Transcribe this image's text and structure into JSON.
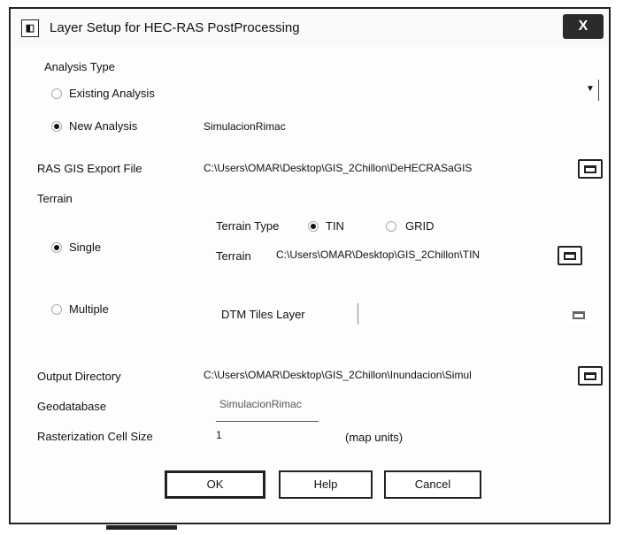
{
  "window": {
    "title": "Layer Setup for HEC-RAS PostProcessing",
    "close_label": "X"
  },
  "analysis": {
    "section_label": "Analysis Type",
    "existing_label": "Existing Analysis",
    "new_label": "New Analysis",
    "new_name": "SimulacionRimac",
    "selected": "new"
  },
  "export": {
    "label": "RAS GIS Export File",
    "path": "C:\\Users\\OMAR\\Desktop\\GIS_2Chillon\\DeHECRASaGIS"
  },
  "terrain": {
    "section_label": "Terrain",
    "single_label": "Single",
    "multiple_label": "Multiple",
    "mode_selected": "single",
    "type_label": "Terrain Type",
    "tin_label": "TIN",
    "grid_label": "GRID",
    "type_selected": "TIN",
    "terrain_label": "Terrain",
    "terrain_path": "C:\\Users\\OMAR\\Desktop\\GIS_2Chillon\\TIN",
    "dtm_label": "DTM Tiles Layer"
  },
  "output": {
    "label": "Output Directory",
    "path": "C:\\Users\\OMAR\\Desktop\\GIS_2Chillon\\Inundacion\\Simul"
  },
  "geodatabase": {
    "label": "Geodatabase",
    "value": "SimulacionRimac"
  },
  "raster": {
    "label": "Rasterization Cell Size",
    "value": "1",
    "units": "(map units)"
  },
  "buttons": {
    "ok": "OK",
    "help": "Help",
    "cancel": "Cancel"
  }
}
